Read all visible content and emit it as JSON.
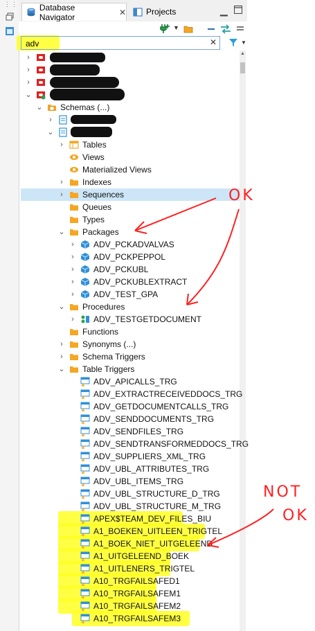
{
  "tabs": [
    {
      "label": "Database Navigator",
      "active": true
    },
    {
      "label": "Projects",
      "active": false
    }
  ],
  "search": {
    "value": "adv"
  },
  "colors": {
    "selection": "#cde6f7",
    "highlight": "#ffff22",
    "annotation": "#ff2020",
    "folder": "#f5a623",
    "package": "#2f8fd8"
  },
  "tree": {
    "schemas_label": "Schemas (...)",
    "folders": {
      "tables": "Tables",
      "views": "Views",
      "materialized_views": "Materialized Views",
      "indexes": "Indexes",
      "sequences": "Sequences",
      "queues": "Queues",
      "types": "Types",
      "packages": "Packages",
      "procedures": "Procedures",
      "functions": "Functions",
      "synonyms": "Synonyms (...)",
      "schema_triggers": "Schema Triggers",
      "table_triggers": "Table Triggers"
    },
    "packages": [
      "ADV_PCKADVALVAS",
      "ADV_PCKPEPPOL",
      "ADV_PCKUBL",
      "ADV_PCKUBLEXTRACT",
      "ADV_TEST_GPA"
    ],
    "procedures": [
      "ADV_TESTGETDOCUMENT"
    ],
    "triggers": [
      "ADV_APICALLS_TRG",
      "ADV_EXTRACTRECEIVEDDOCS_TRG",
      "ADV_GETDOCUMENTCALLS_TRG",
      "ADV_SENDDOCUMENTS_TRG",
      "ADV_SENDFILES_TRG",
      "ADV_SENDTRANSFORMEDDOCS_TRG",
      "ADV_SUPPLIERS_XML_TRG",
      "ADV_UBL_ATTRIBUTES_TRG",
      "ADV_UBL_ITEMS_TRG",
      "ADV_UBL_STRUCTURE_D_TRG",
      "ADV_UBL_STRUCTURE_M_TRG",
      "APEX$TEAM_DEV_FILES_BIU",
      "A1_BOEKEN_UITLEEN_TRIGTEL",
      "A1_BOEK_NIET_UITGELEEND",
      "A1_UITGELEEND_BOEK",
      "A1_UITLENERS_TRIGTEL",
      "A10_TRGFAILSAFED1",
      "A10_TRGFAILSAFEM1",
      "A10_TRGFAILSAFEM2",
      "A10_TRGFAILSAFEM3"
    ]
  },
  "annotations": {
    "ok": "OK",
    "not_ok_line1": "NOT",
    "not_ok_line2": "OK"
  }
}
